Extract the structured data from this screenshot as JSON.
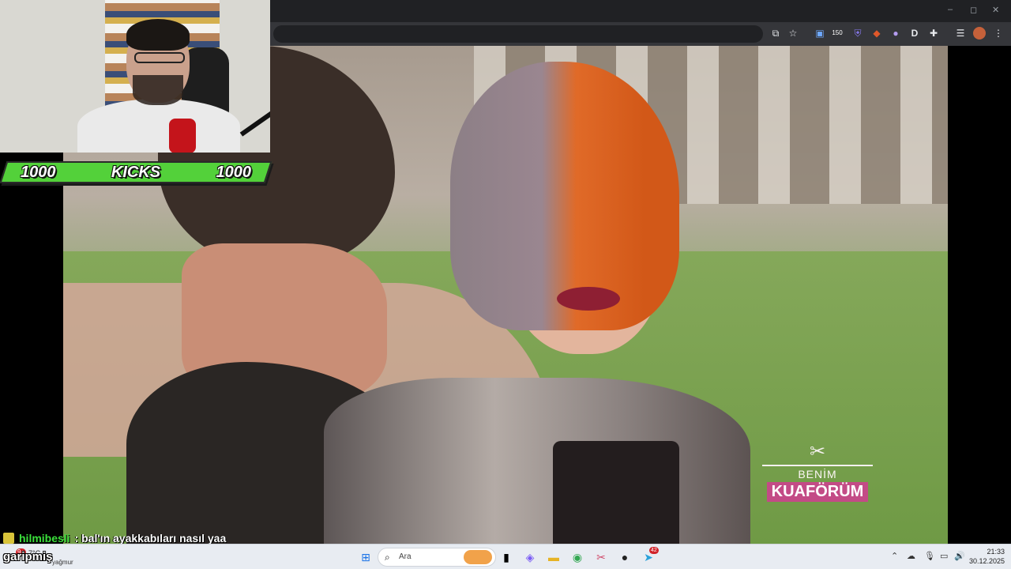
{
  "overlay": {
    "kicks": {
      "left_count": "1000",
      "label": "KICKS",
      "right_count": "1000"
    },
    "chat": {
      "user": "hilmibesli",
      "message": ": bal'ın ayakkabıları nasıl yaa"
    },
    "show_logo": {
      "line1": "BENİM",
      "line2": "KUAFÖRÜM"
    },
    "name_overlay": "garipmiş"
  },
  "browser": {
    "window_controls": {
      "minimize": "–",
      "maximize": "◻",
      "close": "✕"
    },
    "toolbar_icons": [
      "cast-icon",
      "star-icon",
      "extension-translate-icon",
      "extension-150-icon",
      "shield-icon",
      "fox-icon",
      "brain-icon",
      "d-icon",
      "puzzle-icon",
      "reading-list-icon",
      "profile-icon",
      "menu-icon"
    ],
    "extension_badge": "150",
    "d_label": "D"
  },
  "taskbar": {
    "weather": {
      "badge": "9+",
      "temp": "7°C",
      "desc": "yağmur"
    },
    "search_placeholder": "Ara",
    "apps": [
      "windows-start-icon",
      "task-view-icon",
      "copilot-icon",
      "file-explorer-icon",
      "chrome-icon",
      "snipping-tool-icon",
      "obs-icon",
      "telegram-icon"
    ],
    "telegram_badge": "42",
    "clock": {
      "time": "21:33",
      "date": "30.12.2025"
    }
  },
  "colors": {
    "kicks_green": "#53d13a",
    "chat_user": "#3be03b",
    "logo_pink": "#c34b86"
  }
}
